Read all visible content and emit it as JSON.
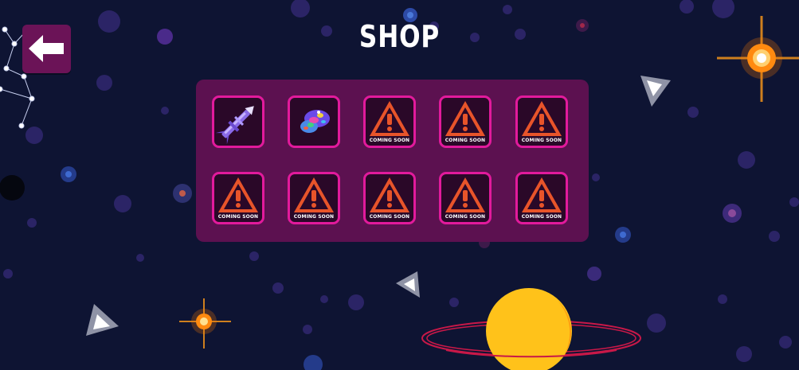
{
  "screen": {
    "title": "SHOP"
  },
  "back_button": {
    "icon": "arrow-left-icon"
  },
  "colors": {
    "background": "#0e1433",
    "panel": "#5c1150",
    "slot_border": "#e21a9c",
    "slot_fill": "#2a0828",
    "warning": "#e8542a",
    "planet": "#ffc21a",
    "ring": "#c81848"
  },
  "shop_items": [
    {
      "type": "item",
      "icon": "rocket-missile-icon",
      "label": ""
    },
    {
      "type": "item",
      "icon": "rainbow-meteor-icon",
      "label": ""
    },
    {
      "type": "locked",
      "icon": "warning-icon",
      "label": "COMING SOON"
    },
    {
      "type": "locked",
      "icon": "warning-icon",
      "label": "COMING SOON"
    },
    {
      "type": "locked",
      "icon": "warning-icon",
      "label": "COMING SOON"
    },
    {
      "type": "locked",
      "icon": "warning-icon",
      "label": "COMING SOON"
    },
    {
      "type": "locked",
      "icon": "warning-icon",
      "label": "COMING SOON"
    },
    {
      "type": "locked",
      "icon": "warning-icon",
      "label": "COMING SOON"
    },
    {
      "type": "locked",
      "icon": "warning-icon",
      "label": "COMING SOON"
    },
    {
      "type": "locked",
      "icon": "warning-icon",
      "label": "COMING SOON"
    }
  ]
}
